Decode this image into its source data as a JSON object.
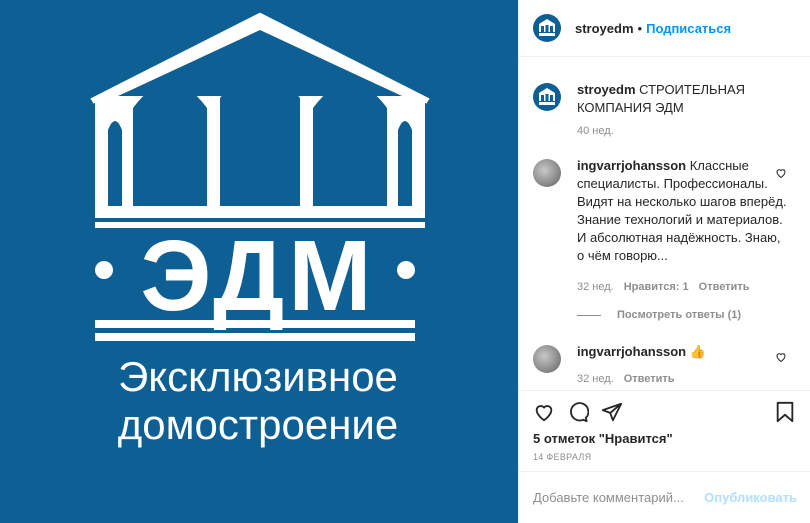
{
  "post": {
    "username": "stroyedm",
    "follow_label": "Подписаться",
    "separator": "•"
  },
  "image": {
    "logo_text": "ЭДМ",
    "tagline_line1": "Эксклюзивное",
    "tagline_line2": "домостроение",
    "background_color": "#0e5f93"
  },
  "caption": {
    "username": "stroyedm",
    "text": "СТРОИТЕЛЬНАЯ КОМПАНИЯ ЭДМ",
    "time": "40 нед."
  },
  "comments": [
    {
      "username": "ingvarrjohansson",
      "text": "Классные специалисты. Профессионалы. Видят на несколько шагов вперёд. Знание технологий и материалов. И абсолютная надёжность. Знаю, о чём говорю...",
      "time": "32 нед.",
      "likes": "Нравится: 1",
      "reply_label": "Ответить",
      "view_replies": "Посмотреть ответы (1)"
    },
    {
      "username": "ingvarrjohansson",
      "text": "👍",
      "time": "32 нед.",
      "reply_label": "Ответить"
    }
  ],
  "stats": {
    "likes": "5 отметок \"Нравится\"",
    "date": "14 ФЕВРАЛЯ"
  },
  "add_comment": {
    "placeholder": "Добавьте комментарий...",
    "publish_label": "Опубликовать"
  },
  "colors": {
    "link": "#0095f6",
    "muted": "#8e8e8e",
    "publish_disabled": "#b2dffc"
  }
}
